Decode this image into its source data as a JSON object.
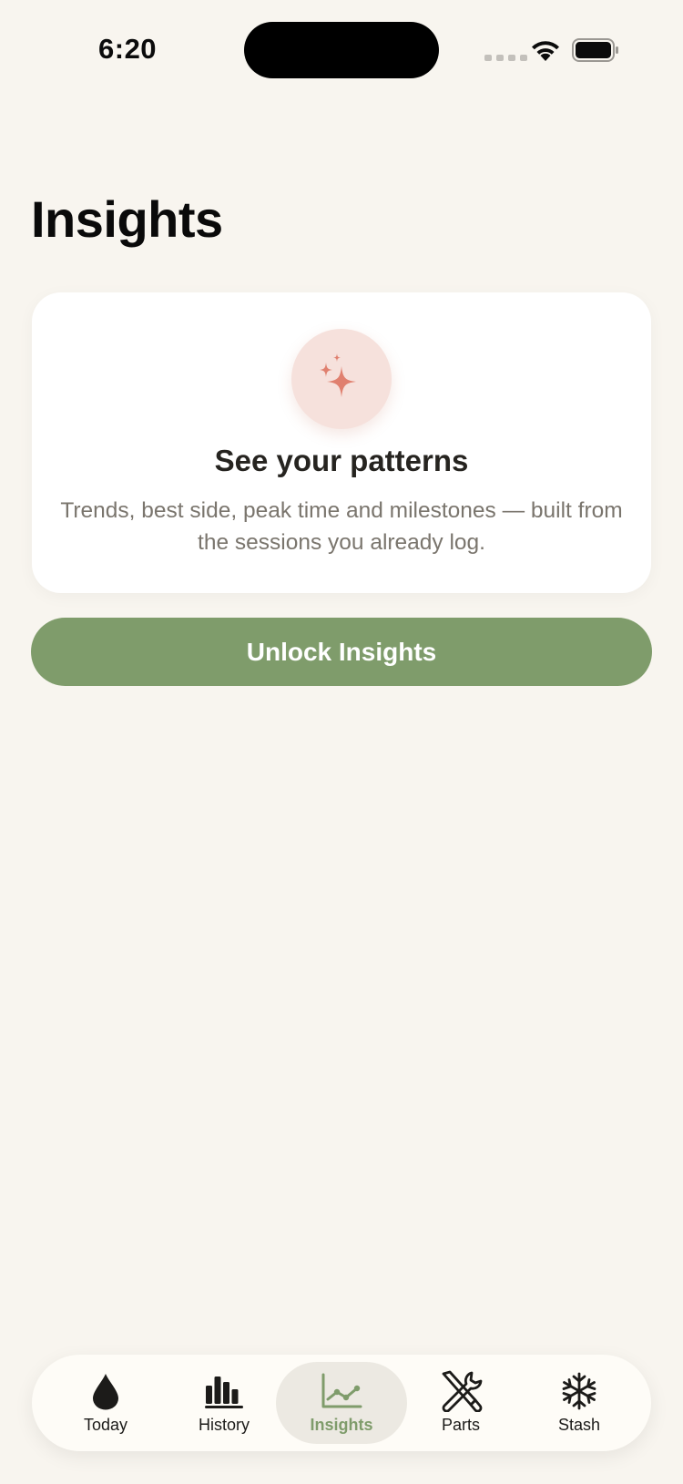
{
  "status_bar": {
    "time": "6:20"
  },
  "page": {
    "title": "Insights"
  },
  "card": {
    "icon": "sparkles-icon",
    "title": "See your patterns",
    "body": "Trends, best side, peak time and milestones — built from the sessions you already log."
  },
  "unlock_button": {
    "label": "Unlock Insights"
  },
  "tabs": [
    {
      "label": "Today",
      "icon": "drop-icon",
      "active": false
    },
    {
      "label": "History",
      "icon": "bar-chart-icon",
      "active": false
    },
    {
      "label": "Insights",
      "icon": "line-chart-icon",
      "active": true
    },
    {
      "label": "Parts",
      "icon": "tools-icon",
      "active": false
    },
    {
      "label": "Stash",
      "icon": "snowflake-icon",
      "active": false
    }
  ],
  "colors": {
    "background": "#f8f5ef",
    "accent_green": "#7f9c6b",
    "sparkle": "#e0806f",
    "badge": "#f6e1dc"
  }
}
